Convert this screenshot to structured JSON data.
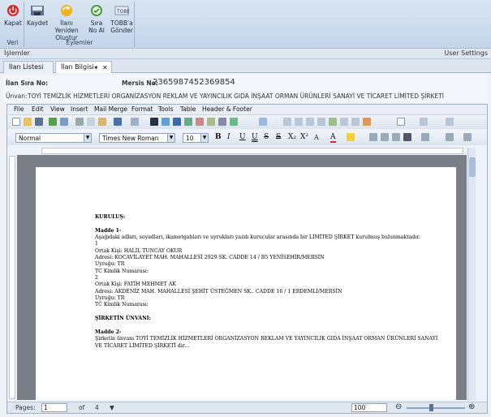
{
  "ribbon": {
    "groups": [
      {
        "label": "Veri",
        "buttons": [
          {
            "label": "Kapat",
            "icon": "power-icon"
          }
        ]
      },
      {
        "label": "Eylemler",
        "buttons": [
          {
            "label": "Kaydet",
            "icon": "save-icon"
          },
          {
            "label": "İlanı Yeniden Oluştur",
            "icon": "refresh-icon"
          },
          {
            "label": "Sıra No Al",
            "icon": "check-icon"
          },
          {
            "label": "TOBB'a Gönder",
            "icon": "send-icon"
          }
        ]
      }
    ]
  },
  "bar": {
    "left": "İşlemler",
    "right": "User Settings"
  },
  "tabs": [
    {
      "label": "İlan Listesi"
    },
    {
      "label": "İlan Bilgisi"
    }
  ],
  "info": {
    "sira_label": "İlan Sıra No:",
    "mersis_label": "Mersis No:",
    "mersis_value": "2365987452369854",
    "unvan_label": "Ünvan:",
    "unvan_value": "TOYİ TEMİZLİK HİZMETLERİ ORGANİZASYON REKLAM VE YAYINCILIK GIDA İNŞAAT ORMAN ÜRÜNLERİ SANAYİ VE TİCARET LİMİTED ŞİRKETİ"
  },
  "editor": {
    "menu": [
      "File",
      "Edit",
      "View",
      "Insert",
      "Mail Merge",
      "Format",
      "Tools",
      "Table",
      "Header & Footer"
    ],
    "style": "Normal",
    "font": "Times New Roman",
    "size": "10",
    "format_buttons": [
      "B",
      "I",
      "U",
      "U",
      "S",
      "S",
      "X₂",
      "X²",
      "A",
      "A"
    ],
    "document_lines": [
      {
        "text": "KURULUŞ:",
        "bold": true
      },
      {
        "text": "",
        "bold": false
      },
      {
        "text": "Madde 1-",
        "bold": true
      },
      {
        "text": "Aşağıdaki adları, soyadları, ikametgahları ve uyrukları yazılı kurucular arasında bir LİMİTED ŞİRKET kurulmuş bulunmaktadır.",
        "bold": false
      },
      {
        "text": "1",
        "bold": false
      },
      {
        "text": "Ortak Kişi: HALİL TUNCAY OKUR",
        "bold": false
      },
      {
        "text": "Adresi: KOCAVİLAYET MAH. MAHALLESİ 2929 SK. CADDE 14 / B5 YENİSEHİR/MERSİN",
        "bold": false
      },
      {
        "text": "Uyruğu: TR",
        "bold": false
      },
      {
        "text": "TC Kimlik Numarası:",
        "bold": false
      },
      {
        "text": "2",
        "bold": false
      },
      {
        "text": "Ortak Kişi: FATİH MEHMET AK",
        "bold": false
      },
      {
        "text": "Adresi: AKDENİZ MAH. MAHALLESİ ŞEHİT ÜSTEĞMEN SK.. CADDE 16 / 1 ERDEMLİ/MERSİN",
        "bold": false
      },
      {
        "text": "Uyruğu: TR",
        "bold": false
      },
      {
        "text": "TC Kimlik Numarası:",
        "bold": false
      },
      {
        "text": "",
        "bold": false
      },
      {
        "text": "ŞİRKETİN ÜNVANI:",
        "bold": true
      },
      {
        "text": "",
        "bold": false
      },
      {
        "text": "Madde 2-",
        "bold": true
      },
      {
        "text": "Şirketin ünvanı TOYİ TEMİZLİK HİZMETLERİ ORGANİZASYON REKLAM VE YAYINCILIK GIDA İNŞAAT ORMAN ÜRÜNLERİ SANAYİ",
        "bold": false
      },
      {
        "text": "VE TİCARET LİMİTED ŞİRKETİ dir...",
        "bold": false
      }
    ]
  },
  "status": {
    "pages_label": "Pages:",
    "page_current": "1",
    "of_label": "of",
    "page_total": "4",
    "zoom": "100"
  }
}
